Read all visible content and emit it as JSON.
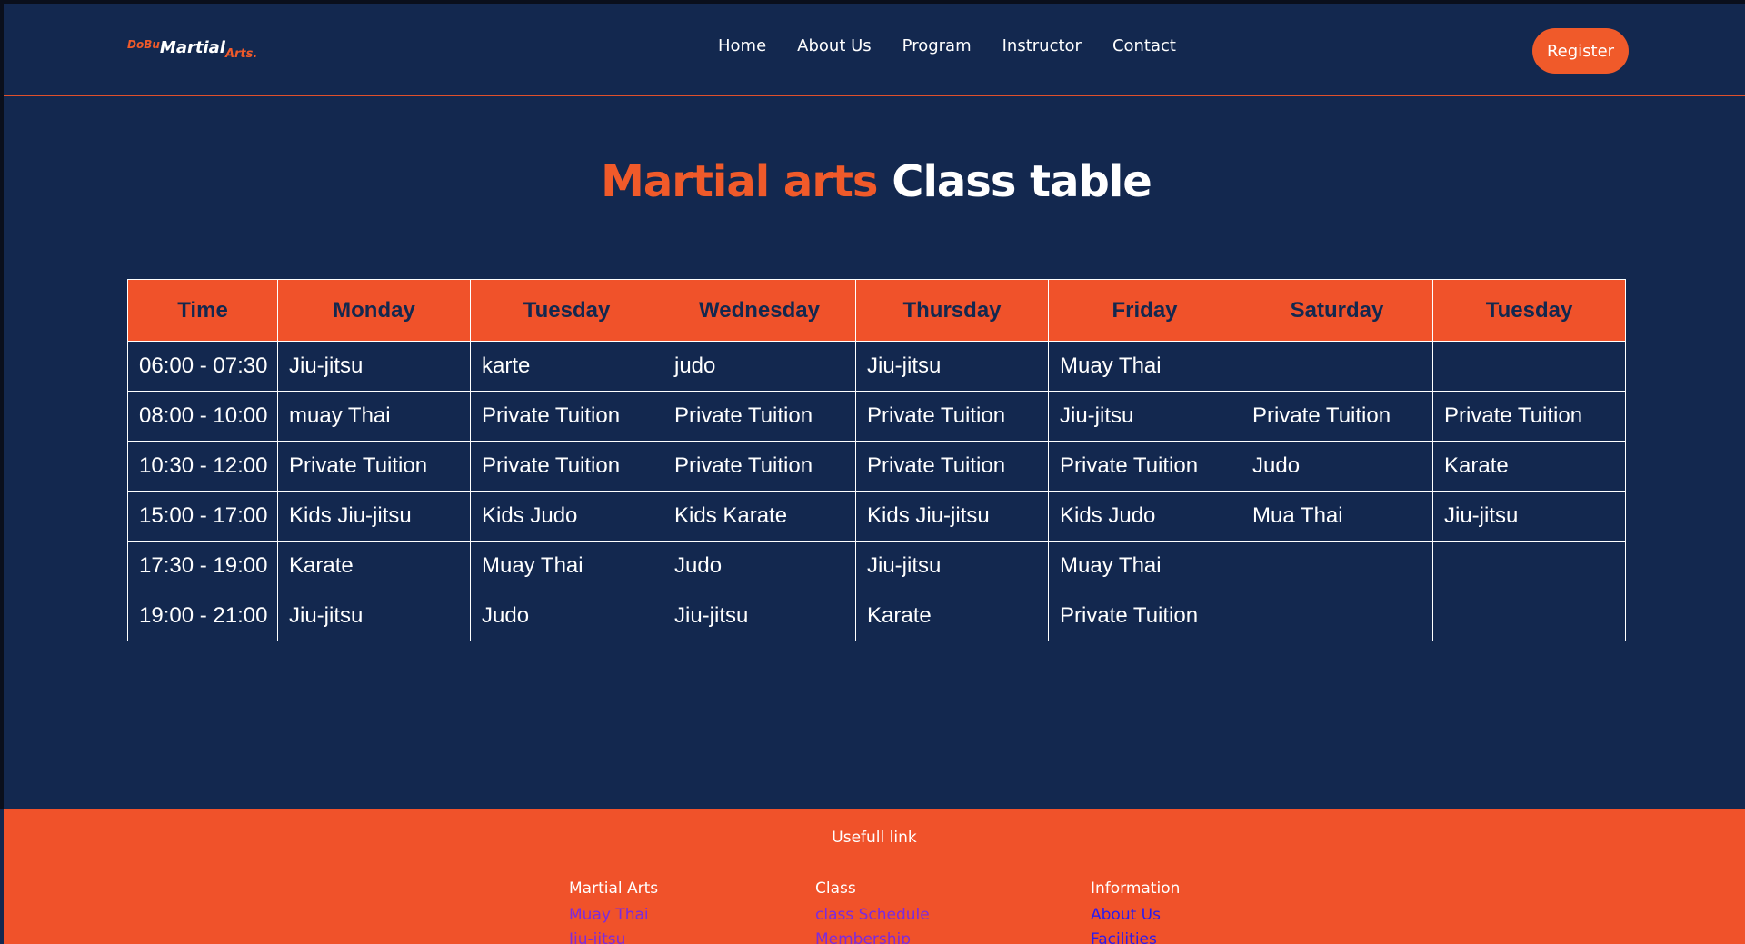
{
  "brand": {
    "part1": "DoBu",
    "part2": "Martial",
    "part3": "Arts."
  },
  "nav": [
    "Home",
    "About Us",
    "Program",
    "Instructor",
    "Contact"
  ],
  "register_label": "Register",
  "title": {
    "accent": "Martial arts",
    "rest": "Class table"
  },
  "schedule": {
    "headers": [
      "Time",
      "Monday",
      "Tuesday",
      "Wednesday",
      "Thursday",
      "Friday",
      "Saturday",
      "Tuesday"
    ],
    "rows": [
      [
        "06:00 - 07:30",
        "Jiu-jitsu",
        "karte",
        "judo",
        "Jiu-jitsu",
        "Muay Thai",
        "",
        ""
      ],
      [
        "08:00 - 10:00",
        "muay Thai",
        "Private Tuition",
        "Private Tuition",
        "Private Tuition",
        "Jiu-jitsu",
        "Private Tuition",
        "Private Tuition"
      ],
      [
        "10:30 - 12:00",
        "Private Tuition",
        "Private Tuition",
        "Private Tuition",
        "Private Tuition",
        "Private Tuition",
        "Judo",
        "Karate"
      ],
      [
        "15:00 - 17:00",
        "Kids Jiu-jitsu",
        "Kids Judo",
        "Kids Karate",
        "Kids Jiu-jitsu",
        "Kids Judo",
        "Mua Thai",
        "Jiu-jitsu"
      ],
      [
        "17:30 - 19:00",
        "Karate",
        "Muay Thai",
        "Judo",
        "Jiu-jitsu",
        "Muay Thai",
        "",
        ""
      ],
      [
        "19:00 - 21:00",
        "Jiu-jitsu",
        "Judo",
        "Jiu-jitsu",
        "Karate",
        "Private Tuition",
        "",
        ""
      ]
    ]
  },
  "footer": {
    "title": "Usefull link",
    "columns": [
      {
        "heading": "Martial Arts",
        "links": [
          "Muay Thai",
          "Jiu-jitsu"
        ]
      },
      {
        "heading": "Class",
        "links": [
          "class Schedule",
          "Membership"
        ]
      },
      {
        "heading": "Information",
        "links": [
          "About Us",
          "Facilities"
        ]
      }
    ]
  },
  "colors": {
    "background": "#13284f",
    "accent": "#f05a2a",
    "link_purple": "#7a2be0",
    "link_blue": "#2a1bf0"
  }
}
